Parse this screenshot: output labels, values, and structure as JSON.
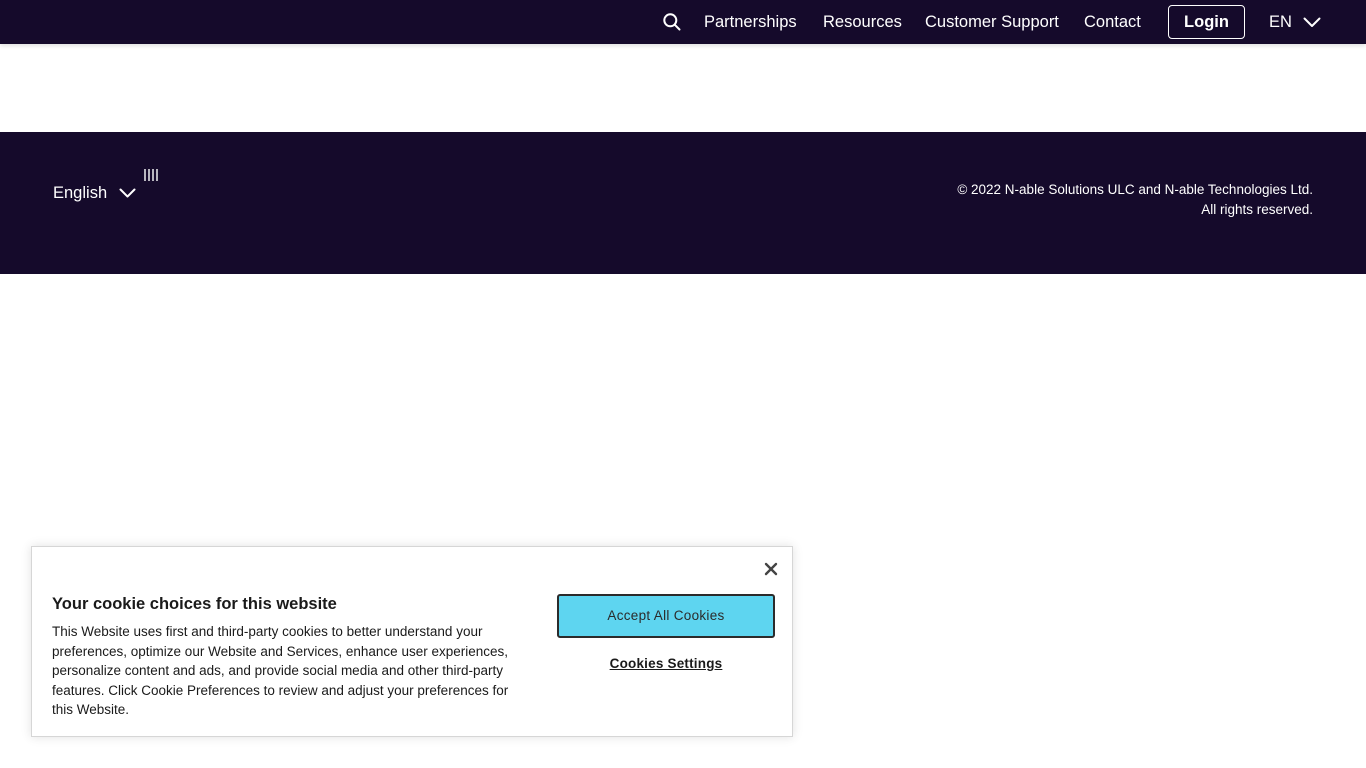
{
  "colors": {
    "nav_background": "#150a2b",
    "footer_background": "#150a2b",
    "accept_button": "#5ed5f0",
    "text_light": "#ffffff"
  },
  "header": {
    "search_icon": "search-icon",
    "nav_links": [
      "Partnerships",
      "Resources",
      "Customer Support",
      "Contact"
    ],
    "login_label": "Login",
    "language_code": "EN",
    "language_icon": "chevron-down-icon"
  },
  "footer": {
    "language_label": "English",
    "language_icon": "chevron-down-icon",
    "copyright_line1": "© 2022 N-able Solutions ULC and N-able Technologies Ltd.",
    "copyright_line2": "All rights reserved."
  },
  "cookie_banner": {
    "title": "Your cookie choices for this website",
    "body": "This Website uses first and third-party cookies to better understand your preferences, optimize our Website and Services, enhance user experiences, personalize content and ads, and provide social media and other third-party features. Click Cookie Preferences to review and adjust your preferences for this Website.",
    "accept_label": "Accept All Cookies",
    "settings_label": "Cookies Settings",
    "close_icon": "close-icon"
  }
}
